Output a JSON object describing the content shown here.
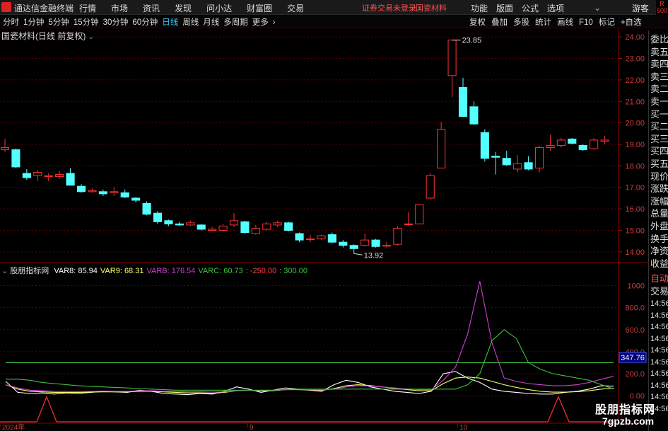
{
  "topbar": {
    "app_title": "通达信金融终端",
    "menu": [
      "行情",
      "市场",
      "资讯",
      "发现",
      "问小达",
      "财富圈",
      "交易"
    ],
    "notice": "证券交易未登录",
    "stock_name": "国瓷材料",
    "right_menu": [
      "功能",
      "版面",
      "公式",
      "选项"
    ],
    "guest": "游客"
  },
  "toolbar": {
    "periods": [
      "分时",
      "1分钟",
      "5分钟",
      "15分钟",
      "30分钟",
      "60分钟",
      "日线",
      "周线",
      "月线",
      "多周期",
      "更多"
    ],
    "active_period": "日线",
    "tools": [
      "复权",
      "叠加",
      "多股",
      "统计",
      "画线",
      "F10",
      "标记",
      "+自选"
    ],
    "more_arrow": "›"
  },
  "red_box": [
    "R",
    "500"
  ],
  "main_chart": {
    "title": "国瓷材料(日线 前复权)",
    "price_axis": [
      "24.00",
      "23.00",
      "22.00",
      "21.00",
      "20.00",
      "19.00",
      "18.00",
      "17.00",
      "16.00",
      "15.00",
      "14.00"
    ],
    "high_label": "23.85",
    "low_label": "13.92"
  },
  "indicator": {
    "name": "股朋指标网",
    "legend": [
      {
        "label": "VAR8: 85.94",
        "color": "#ffffff"
      },
      {
        "label": "VAR9: 68.31",
        "color": "#ffff66"
      },
      {
        "label": "VARB: 176.54",
        "color": "#d040d0"
      },
      {
        "label": "VARC: 60.73",
        "color": "#40c040"
      },
      {
        "label": ": -250.00",
        "color": "#ff4040"
      },
      {
        "label": ": 300.00",
        "color": "#40c040"
      }
    ],
    "axis": [
      "1000",
      "800.0",
      "600.0",
      "400.0",
      "200.0",
      "0.00"
    ],
    "cursor_value": "347.76"
  },
  "date_axis": [
    "2024年",
    "9",
    "10"
  ],
  "right_panel": {
    "items": [
      "委比",
      "卖五",
      "卖四",
      "卖三",
      "卖二",
      "卖一",
      "买一",
      "买二",
      "买三",
      "买四",
      "买五",
      "现价",
      "涨跌",
      "涨幅",
      "总量",
      "外盘",
      "换手",
      "净资",
      "收益"
    ],
    "tabs": [
      "自动",
      "交易"
    ],
    "times": [
      "14:56",
      "14:56",
      "14:56",
      "14:56",
      "14:56",
      "14:56",
      "14:56",
      "14:56",
      "14:56",
      "14:56"
    ]
  },
  "watermark": {
    "line1": "股朋指标网",
    "line2": "7gpzb.com"
  },
  "chart_data": {
    "type": "candlestick",
    "candles": [
      [
        18.75,
        18.85,
        18.65,
        19.25
      ],
      [
        18.75,
        17.95,
        17.9,
        18.8
      ],
      [
        17.65,
        17.45,
        17.35,
        17.85
      ],
      [
        17.55,
        17.7,
        17.3,
        17.8
      ],
      [
        17.5,
        17.55,
        17.3,
        17.65
      ],
      [
        17.5,
        17.6,
        17.4,
        17.75
      ],
      [
        17.65,
        17.1,
        17.1,
        17.9
      ],
      [
        17.05,
        16.8,
        16.75,
        17.15
      ],
      [
        16.8,
        16.85,
        16.75,
        16.95
      ],
      [
        16.8,
        16.7,
        16.6,
        16.9
      ],
      [
        16.75,
        16.8,
        16.6,
        17.0
      ],
      [
        16.75,
        16.55,
        16.5,
        16.9
      ],
      [
        16.5,
        16.4,
        16.3,
        16.55
      ],
      [
        16.25,
        15.75,
        15.7,
        16.35
      ],
      [
        15.8,
        15.4,
        15.3,
        15.9
      ],
      [
        15.45,
        15.3,
        15.2,
        15.5
      ],
      [
        15.3,
        15.25,
        15.2,
        15.4
      ],
      [
        15.25,
        15.35,
        15.2,
        15.45
      ],
      [
        15.25,
        15.05,
        15.0,
        15.3
      ],
      [
        15.0,
        15.05,
        15.0,
        15.15
      ],
      [
        15.0,
        15.2,
        14.95,
        15.3
      ],
      [
        15.25,
        15.45,
        15.15,
        15.8
      ],
      [
        15.4,
        14.9,
        14.85,
        15.45
      ],
      [
        14.85,
        15.1,
        14.8,
        15.25
      ],
      [
        15.05,
        15.3,
        15.0,
        15.4
      ],
      [
        15.25,
        15.35,
        15.15,
        15.45
      ],
      [
        15.35,
        15.0,
        14.95,
        15.4
      ],
      [
        14.85,
        14.55,
        14.45,
        14.9
      ],
      [
        14.6,
        14.6,
        14.45,
        14.8
      ],
      [
        14.6,
        14.75,
        14.55,
        14.8
      ],
      [
        14.8,
        14.45,
        14.4,
        14.9
      ],
      [
        14.45,
        14.3,
        14.2,
        14.55
      ],
      [
        14.3,
        14.15,
        13.92,
        14.35
      ],
      [
        14.3,
        14.55,
        14.25,
        14.85
      ],
      [
        14.55,
        14.25,
        14.2,
        14.6
      ],
      [
        14.3,
        14.3,
        14.2,
        14.45
      ],
      [
        14.35,
        15.1,
        14.3,
        15.2
      ],
      [
        15.3,
        15.3,
        15.2,
        15.85
      ],
      [
        15.3,
        16.2,
        15.3,
        16.2
      ],
      [
        16.5,
        17.55,
        16.45,
        17.65
      ],
      [
        17.9,
        19.7,
        17.9,
        20.05
      ],
      [
        22.2,
        23.85,
        21.2,
        23.85
      ],
      [
        21.65,
        20.3,
        20.3,
        22.1
      ],
      [
        20.75,
        19.95,
        19.9,
        21.0
      ],
      [
        19.55,
        18.35,
        18.2,
        19.7
      ],
      [
        18.45,
        18.4,
        17.6,
        18.65
      ],
      [
        18.35,
        18.05,
        18.0,
        18.7
      ],
      [
        17.85,
        18.1,
        17.7,
        18.5
      ],
      [
        18.15,
        17.85,
        17.8,
        18.45
      ],
      [
        17.9,
        18.85,
        17.7,
        18.95
      ],
      [
        18.85,
        18.95,
        18.7,
        19.45
      ],
      [
        18.95,
        19.2,
        18.85,
        19.3
      ],
      [
        19.25,
        19.05,
        19.0,
        19.3
      ],
      [
        18.95,
        18.75,
        18.7,
        19.0
      ],
      [
        18.8,
        19.2,
        18.75,
        19.3
      ],
      [
        19.15,
        19.2,
        19.0,
        19.4
      ]
    ],
    "indicator_series": [
      {
        "name": "VAR8",
        "values": [
          130,
          30,
          20,
          25,
          15,
          25,
          20,
          30,
          40,
          35,
          30,
          50,
          40,
          20,
          15,
          10,
          20,
          15,
          40,
          80,
          60,
          30,
          50,
          70,
          60,
          50,
          40,
          100,
          140,
          120,
          80,
          60,
          40,
          30,
          20,
          40,
          200,
          220,
          160,
          120,
          60,
          40,
          30,
          20,
          15,
          15,
          30,
          40,
          60,
          90,
          86
        ]
      },
      {
        "name": "VAR9",
        "values": [
          100,
          60,
          40,
          35,
          30,
          30,
          30,
          32,
          35,
          35,
          35,
          40,
          40,
          35,
          30,
          25,
          25,
          22,
          30,
          45,
          50,
          42,
          45,
          55,
          55,
          52,
          48,
          65,
          90,
          100,
          92,
          80,
          65,
          55,
          45,
          45,
          110,
          160,
          170,
          160,
          130,
          100,
          75,
          55,
          40,
          32,
          32,
          36,
          45,
          60,
          68
        ]
      },
      {
        "name": "VARB",
        "values": [
          100,
          70,
          50,
          45,
          40,
          38,
          38,
          40,
          42,
          40,
          40,
          45,
          45,
          40,
          38,
          35,
          35,
          32,
          35,
          45,
          50,
          45,
          48,
          55,
          58,
          55,
          52,
          60,
          80,
          90,
          88,
          80,
          70,
          62,
          55,
          55,
          140,
          260,
          560,
          1040,
          480,
          160,
          130,
          110,
          100,
          90,
          90,
          100,
          120,
          150,
          176
        ]
      },
      {
        "name": "VARC",
        "values": [
          150,
          150,
          140,
          120,
          110,
          100,
          90,
          85,
          80,
          75,
          70,
          65,
          60,
          55,
          50,
          50,
          50,
          50,
          50,
          50,
          50,
          50,
          50,
          55,
          60,
          60,
          60,
          60,
          60,
          60,
          60,
          60,
          60,
          60,
          60,
          60,
          60,
          60,
          100,
          200,
          500,
          600,
          520,
          300,
          240,
          200,
          180,
          160,
          140,
          100,
          61
        ]
      }
    ],
    "hlines": [
      300,
      -250
    ],
    "indicator_ylim": [
      -250,
      1100
    ],
    "price_ylim": [
      13.6,
      24.4
    ]
  }
}
